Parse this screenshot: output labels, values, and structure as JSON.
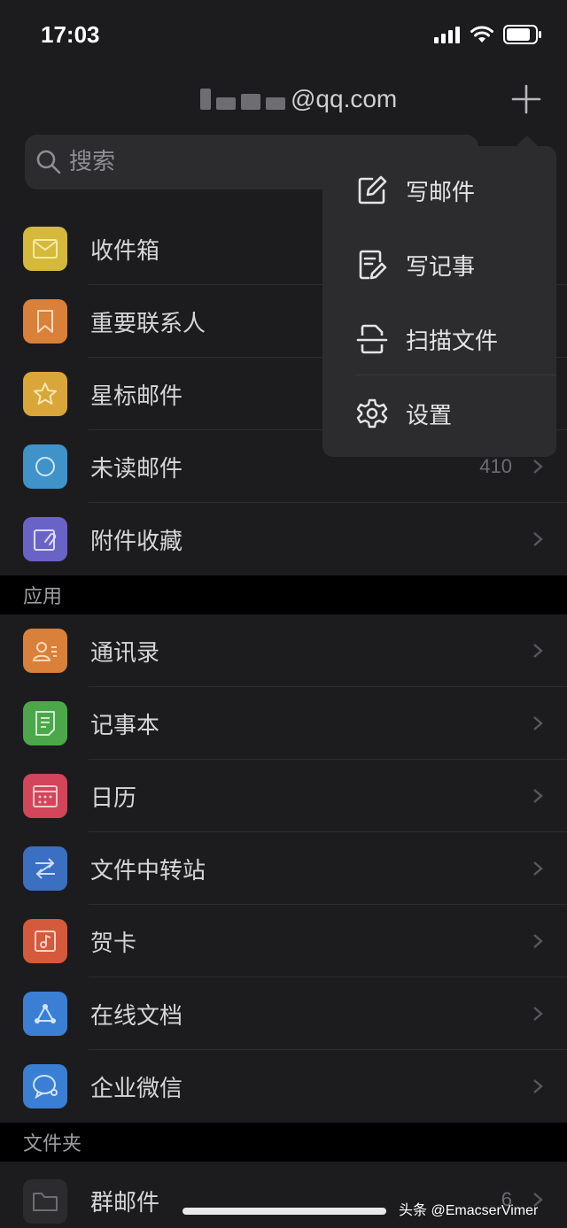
{
  "status_bar": {
    "time": "17:03"
  },
  "header": {
    "account": "@qq.com"
  },
  "search": {
    "placeholder": "搜索"
  },
  "mailbox_rows": [
    {
      "label": "收件箱",
      "icon": "inbox-icon",
      "color": "#d4b93a"
    },
    {
      "label": "重要联系人",
      "icon": "bookmark-icon",
      "color": "#d9803a"
    },
    {
      "label": "星标邮件",
      "icon": "star-icon",
      "color": "#d9a63a"
    },
    {
      "label": "未读邮件",
      "icon": "circle-icon",
      "color": "#3f93c9",
      "count": "410"
    },
    {
      "label": "附件收藏",
      "icon": "attachment-icon",
      "color": "#6a63c7"
    }
  ],
  "sections": {
    "apps": "应用",
    "folders": "文件夹"
  },
  "app_rows": [
    {
      "label": "通讯录",
      "icon": "contacts-icon",
      "color": "#d9803a"
    },
    {
      "label": "记事本",
      "icon": "notepad-icon",
      "color": "#4ca74a"
    },
    {
      "label": "日历",
      "icon": "calendar-icon",
      "color": "#d2455a"
    },
    {
      "label": "文件中转站",
      "icon": "transfer-icon",
      "color": "#3b6fc2"
    },
    {
      "label": "贺卡",
      "icon": "card-icon",
      "color": "#d55a3c"
    },
    {
      "label": "在线文档",
      "icon": "doc-share-icon",
      "color": "#3a7fd4"
    },
    {
      "label": "企业微信",
      "icon": "wework-icon",
      "color": "#3a7fd4"
    }
  ],
  "folder_rows": [
    {
      "label": "群邮件",
      "icon": "folder-icon",
      "count": "6"
    }
  ],
  "menu": {
    "items": [
      {
        "label": "写邮件",
        "icon": "compose-icon"
      },
      {
        "label": "写记事",
        "icon": "note-edit-icon"
      },
      {
        "label": "扫描文件",
        "icon": "scan-icon"
      },
      {
        "label": "设置",
        "icon": "gear-icon"
      }
    ]
  },
  "watermark": "头条 @EmacserVimer"
}
